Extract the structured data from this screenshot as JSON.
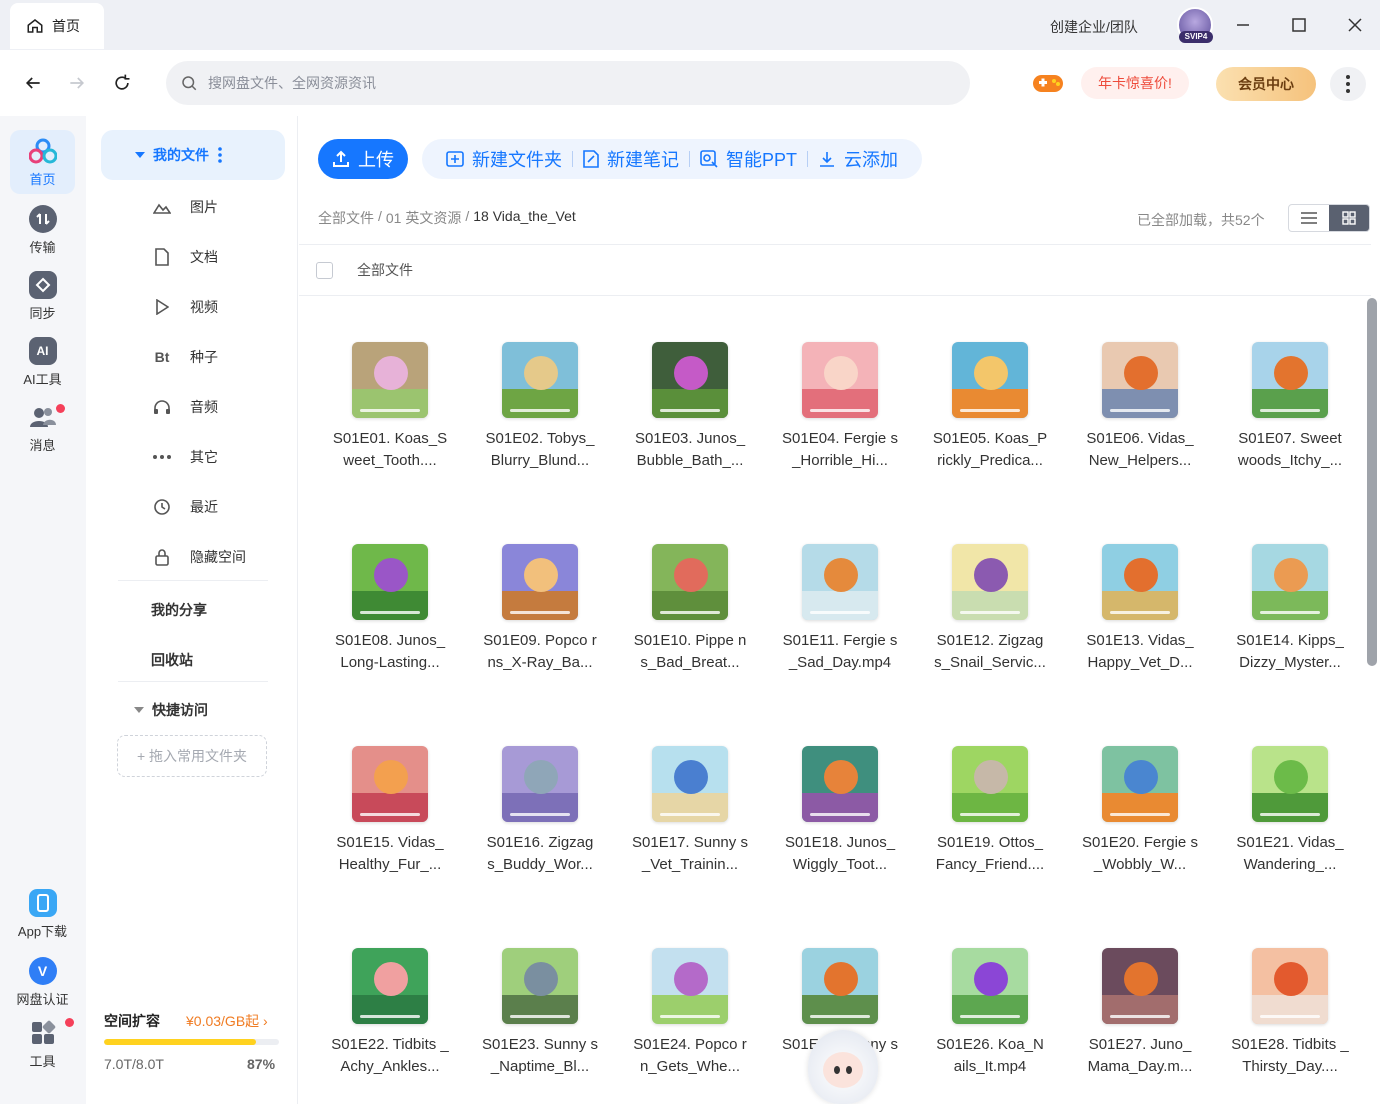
{
  "window": {
    "tab_label": "首页",
    "create_team": "创建企业/团队",
    "avatar_badge": "SVIP4"
  },
  "nav": {
    "search_placeholder": "搜网盘文件、全网资源资讯",
    "promo": "年卡惊喜价!",
    "vip": "会员中心"
  },
  "rail": {
    "items": [
      {
        "label": "首页",
        "icon": "home-cloud-icon"
      },
      {
        "label": "传输",
        "icon": "transfer-icon"
      },
      {
        "label": "同步",
        "icon": "sync-icon"
      },
      {
        "label": "AI工具",
        "icon": "ai-icon"
      },
      {
        "label": "消息",
        "icon": "message-icon"
      }
    ],
    "bottom": [
      {
        "label": "App下载",
        "icon": "phone-icon"
      },
      {
        "label": "网盘认证",
        "icon": "verify-icon"
      },
      {
        "label": "工具",
        "icon": "tools-icon"
      }
    ]
  },
  "sidebar": {
    "my_files": "我的文件",
    "items": [
      {
        "label": "图片",
        "icon": "image-icon"
      },
      {
        "label": "文档",
        "icon": "document-icon"
      },
      {
        "label": "视频",
        "icon": "video-icon"
      },
      {
        "label": "种子",
        "icon": "bt-icon",
        "glyph": "Bt"
      },
      {
        "label": "音频",
        "icon": "audio-icon"
      },
      {
        "label": "其它",
        "icon": "more-icon"
      },
      {
        "label": "最近",
        "icon": "recent-icon"
      },
      {
        "label": "隐藏空间",
        "icon": "lock-icon"
      }
    ],
    "my_share": "我的分享",
    "recycle": "回收站",
    "quick_access": "快捷访问",
    "drop_zone": "+ 拖入常用文件夹",
    "storage": {
      "title": "空间扩容",
      "price": "¥0.03/GB起",
      "used": "7.0T/8.0T",
      "percent_label": "87%",
      "percent": 87
    }
  },
  "toolbar": {
    "upload": "上传",
    "new_folder": "新建文件夹",
    "new_note": "新建笔记",
    "smart_ppt": "智能PPT",
    "cloud_add": "云添加"
  },
  "breadcrumb": {
    "root": "全部文件",
    "sep": "/",
    "level1": "01 英文资源",
    "current": "18 Vida_the_Vet"
  },
  "status": {
    "loaded": "已全部加载，共52个"
  },
  "list": {
    "header": "全部文件"
  },
  "colors": {
    "accent": "#1677ff",
    "promo_text": "#ee4b3b",
    "storage_fill": "#ffd21f"
  },
  "files": [
    {
      "name": "S01E01. Koas_S weet_Tooth....",
      "c1": "#b9a37a",
      "c2": "#9bc46f",
      "c3": "#e7b2d8"
    },
    {
      "name": "S01E02. Tobys_ Blurry_Blund...",
      "c1": "#7fbfd9",
      "c2": "#6ea544",
      "c3": "#e5c98a"
    },
    {
      "name": "S01E03. Junos_ Bubble_Bath_...",
      "c1": "#3f5e3b",
      "c2": "#5a8f3a",
      "c3": "#c55ac7"
    },
    {
      "name": "S01E04. Fergie s_Horrible_Hi...",
      "c1": "#f4b3b8",
      "c2": "#e36f7b",
      "c3": "#f9d5c8"
    },
    {
      "name": "S01E05. Koas_P rickly_Predica...",
      "c1": "#62b5d8",
      "c2": "#e98a32",
      "c3": "#f3c66a"
    },
    {
      "name": "S01E06. Vidas_ New_Helpers...",
      "c1": "#e9c9b1",
      "c2": "#7e8fb0",
      "c3": "#e36f2e"
    },
    {
      "name": "S01E07. Sweet woods_Itchy_...",
      "c1": "#a8d3ea",
      "c2": "#5aa04c",
      "c3": "#e3742e"
    },
    {
      "name": "S01E08. Junos_ Long-Lasting...",
      "c1": "#6fb84a",
      "c2": "#3f8a34",
      "c3": "#9a56c7"
    },
    {
      "name": "S01E09. Popco rns_X-Ray_Ba...",
      "c1": "#8a86d9",
      "c2": "#c57b3e",
      "c3": "#f2c07c"
    },
    {
      "name": "S01E10. Pippe ns_Bad_Breat...",
      "c1": "#84b55a",
      "c2": "#5f8f3c",
      "c3": "#e16b5c"
    },
    {
      "name": "S01E11. Fergie s_Sad_Day.mp4",
      "c1": "#b5dbe8",
      "c2": "#d7e9ef",
      "c3": "#e58a3c"
    },
    {
      "name": "S01E12. Zigzag s_Snail_Servic...",
      "c1": "#f1e6a8",
      "c2": "#c9ddb0",
      "c3": "#8b5ab0"
    },
    {
      "name": "S01E13. Vidas_ Happy_Vet_D...",
      "c1": "#8fcfe3",
      "c2": "#d5b76b",
      "c3": "#e36f2e"
    },
    {
      "name": "S01E14. Kipps_ Dizzy_Myster...",
      "c1": "#a6d8e2",
      "c2": "#7cb95a",
      "c3": "#eb9b52"
    },
    {
      "name": "S01E15. Vidas_ Healthy_Fur_...",
      "c1": "#e48f8a",
      "c2": "#c84a5a",
      "c3": "#f3a04f"
    },
    {
      "name": "S01E16. Zigzag s_Buddy_Wor...",
      "c1": "#a79ad6",
      "c2": "#7d70b8",
      "c3": "#8fa6b8"
    },
    {
      "name": "S01E17. Sunny s_Vet_Trainin...",
      "c1": "#b7e0ee",
      "c2": "#e6d6a6",
      "c3": "#4a7fd0"
    },
    {
      "name": "S01E18. Junos_ Wiggly_Toot...",
      "c1": "#3f8f7e",
      "c2": "#8c5aa5",
      "c3": "#e7833a"
    },
    {
      "name": "S01E19. Ottos_ Fancy_Friend....",
      "c1": "#9ed662",
      "c2": "#6db643",
      "c3": "#c6b8a8"
    },
    {
      "name": "S01E20. Fergie s_Wobbly_W...",
      "c1": "#7ec2a1",
      "c2": "#e98a32",
      "c3": "#4a86d0"
    },
    {
      "name": "S01E21. Vidas_ Wandering_...",
      "c1": "#b9e38a",
      "c2": "#4f9a3a",
      "c3": "#6cbb49"
    },
    {
      "name": "S01E22. Tidbits _Achy_Ankles...",
      "c1": "#3fa35a",
      "c2": "#2d7f45",
      "c3": "#f0a0a0"
    },
    {
      "name": "S01E23. Sunny s_Naptime_Bl...",
      "c1": "#9fcf7c",
      "c2": "#5b7f4c",
      "c3": "#7a8fa0"
    },
    {
      "name": "S01E24. Popco rn_Gets_Whe...",
      "c1": "#c3e0ef",
      "c2": "#9ccf6c",
      "c3": "#b46ac9"
    },
    {
      "name": "S01E25. Sunny s_B...",
      "c1": "#9bd2e0",
      "c2": "#5e8f4c",
      "c3": "#e3742e"
    },
    {
      "name": "S01E26. Koa_N ails_It.mp4",
      "c1": "#a7dba0",
      "c2": "#5da750",
      "c3": "#8b46d6"
    },
    {
      "name": "S01E27. Juno_ Mama_Day.m...",
      "c1": "#6b4b5d",
      "c2": "#a26d6d",
      "c3": "#e3742e"
    },
    {
      "name": "S01E28. Tidbits _Thirsty_Day....",
      "c1": "#f4c0a2",
      "c2": "#f0dcd0",
      "c3": "#e35a2e"
    }
  ]
}
